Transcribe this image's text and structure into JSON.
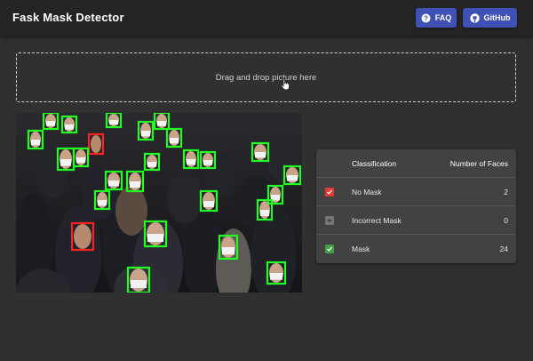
{
  "app": {
    "title": "Fask Mask Detector"
  },
  "header": {
    "faq_label": "FAQ",
    "github_label": "GitHub",
    "accent": "#3f51b5"
  },
  "dropzone": {
    "text": "Drag and drop picture here"
  },
  "results": {
    "columns": [
      "Classification",
      "Number of Faces"
    ],
    "rows": [
      {
        "label": "No Mask",
        "count": "2",
        "color": "#e53935",
        "icon": "x-icon"
      },
      {
        "label": "Incorrect Mask",
        "count": "0",
        "color": "#757575",
        "icon": "minus-icon"
      },
      {
        "label": "Mask",
        "count": "24",
        "color": "#43a047",
        "icon": "check-icon"
      }
    ]
  },
  "detections": {
    "mask_color": "#22ff22",
    "no_mask_color": "#ff2222"
  }
}
